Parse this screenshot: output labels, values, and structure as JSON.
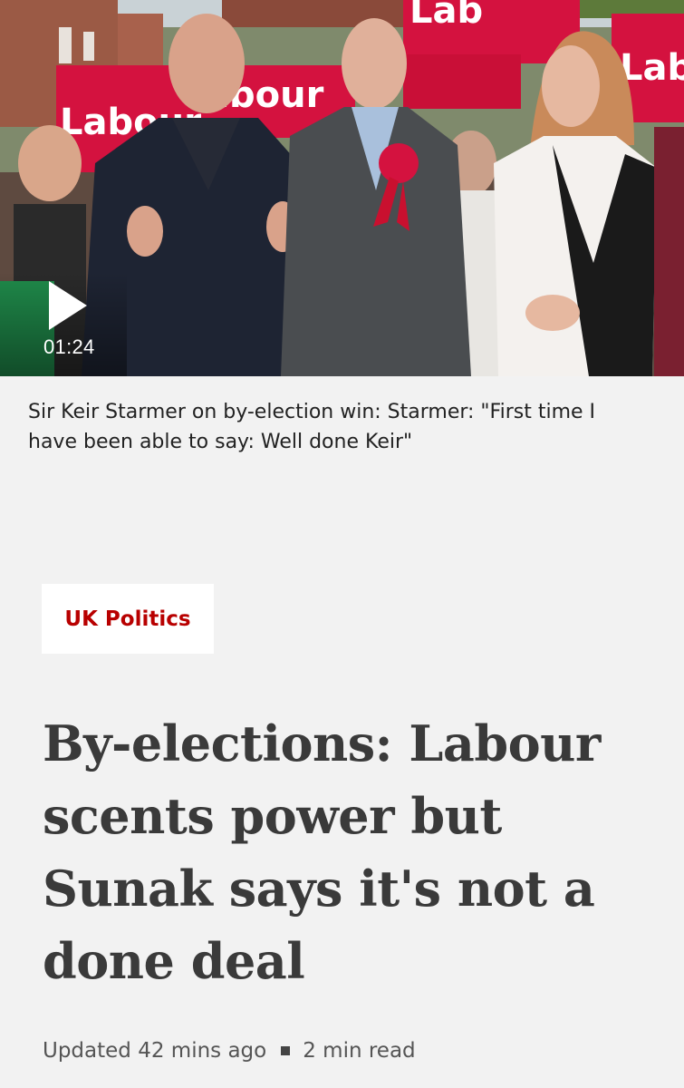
{
  "video": {
    "duration": "01:24",
    "play_icon": "play-icon",
    "sign_texts": [
      "Labour",
      "abour",
      "Lab",
      "Lab"
    ]
  },
  "caption": "Sir Keir Starmer on by-election win: Starmer: \"First time I have been able to say: Well done Keir\"",
  "tag": "UK Politics",
  "headline": "By-elections: Labour scents power but Sunak says it's not a done deal",
  "meta": {
    "updated": "Updated 42 mins ago",
    "read_time": "2 min read"
  },
  "colors": {
    "page_background": "#f2f2f2",
    "tag_text": "#b80000",
    "headline_text": "#3a3a3a",
    "labour_red": "#d4123f"
  }
}
